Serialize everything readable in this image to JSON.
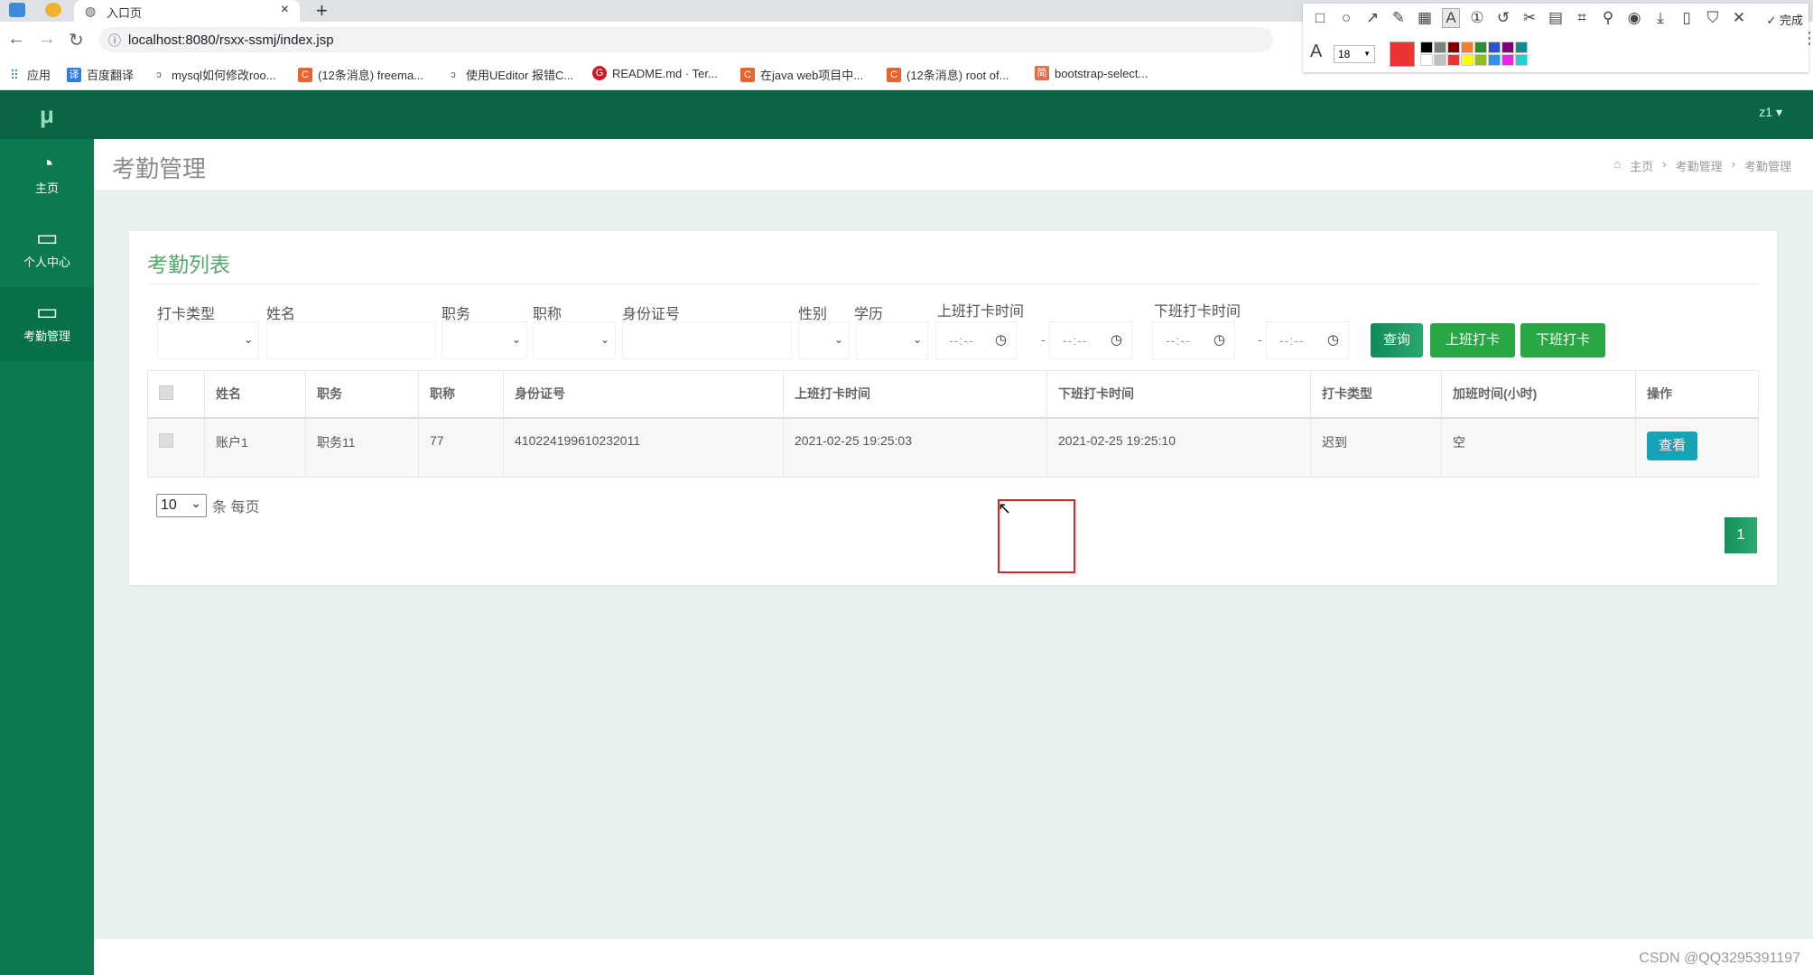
{
  "browser": {
    "tab_title": "入口页",
    "url": "localhost:8080/rsxx-ssmj/index.jsp",
    "bookmarks": [
      {
        "label": "应用",
        "icon": "apps-grid-icon",
        "color": "#4285f4"
      },
      {
        "label": "百度翻译",
        "icon": "baidu-translate-icon",
        "color": "#2f7ce8"
      },
      {
        "label": "mysql如何修改roo...",
        "icon": "blog-icon",
        "color": "#555555"
      },
      {
        "label": "(12条消息) freema...",
        "icon": "csdn-icon",
        "color": "#e8632e"
      },
      {
        "label": "使用UEditor 报错C...",
        "icon": "blog-icon",
        "color": "#555555"
      },
      {
        "label": "README.md · Ter...",
        "icon": "gitee-icon",
        "color": "#c71d23"
      },
      {
        "label": "在java web项目中...",
        "icon": "csdn-icon",
        "color": "#e8632e"
      },
      {
        "label": "(12条消息) root of...",
        "icon": "csdn-icon",
        "color": "#e8632e"
      },
      {
        "label": "bootstrap-select...",
        "icon": "jianshu-icon",
        "color": "#e26c4e"
      }
    ]
  },
  "snip_tool": {
    "done_label": "完成",
    "font_size": "18",
    "current_color": "#ee3333",
    "palette": [
      "#000000",
      "#808080",
      "#800000",
      "#f08030",
      "#2e8b2e",
      "#3050d0",
      "#800080",
      "#108c8c",
      "#ffffff",
      "#c0c0c0",
      "#ee3333",
      "#ffff00",
      "#90c020",
      "#3090f0",
      "#f020f0",
      "#20d0d0"
    ]
  },
  "app": {
    "logo": "μ",
    "user": "z1",
    "sidebar": [
      {
        "label": "主页",
        "icon": "dashboard-icon"
      },
      {
        "label": "个人中心",
        "icon": "monitor-icon"
      },
      {
        "label": "考勤管理",
        "icon": "monitor-icon"
      }
    ],
    "page_title": "考勤管理",
    "breadcrumb": [
      "主页",
      "考勤管理",
      "考勤管理"
    ]
  },
  "card": {
    "title": "考勤列表",
    "filters": {
      "punch_type": "打卡类型",
      "name": "姓名",
      "position": "职务",
      "title": "职称",
      "id_number": "身份证号",
      "gender": "性别",
      "education": "学历",
      "checkin_time": "上班打卡时间",
      "checkout_time": "下班打卡时间",
      "time_placeholder": "--:--"
    },
    "buttons": {
      "query": "查询",
      "checkin": "上班打卡",
      "checkout": "下班打卡"
    },
    "table": {
      "headers": [
        "姓名",
        "职务",
        "职称",
        "身份证号",
        "上班打卡时间",
        "下班打卡时间",
        "打卡类型",
        "加班时间(小时)",
        "操作"
      ],
      "rows": [
        {
          "name": "账户1",
          "position": "职务11",
          "title": "77",
          "id_number": "410224199610232011",
          "checkin": "2021-02-25 19:25:03",
          "checkout": "2021-02-25 19:25:10",
          "punch_type": "迟到",
          "overtime": "空",
          "action": "查看"
        }
      ]
    },
    "pager": {
      "page_size": "10",
      "suffix": "条 每页",
      "current_page": "1"
    }
  },
  "watermark": "CSDN @QQ3295391197"
}
